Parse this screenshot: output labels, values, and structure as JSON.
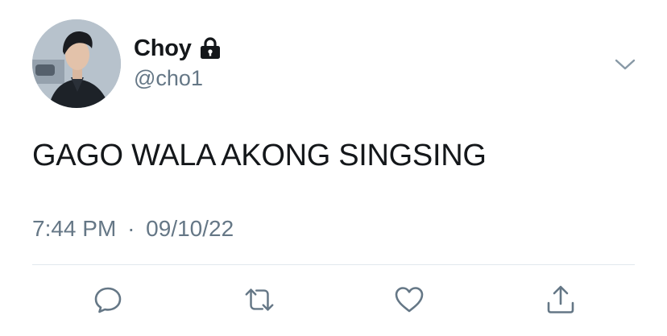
{
  "user": {
    "display_name": "Choy",
    "handle": "@cho1",
    "protected_icon": "lock-icon",
    "avatar": "profile-photo"
  },
  "tweet": {
    "text": "GAGO WALA AKONG SINGSING",
    "time": "7:44 PM",
    "separator": "·",
    "date": "09/10/22"
  },
  "menu_icon": "chevron-down-icon",
  "actions": [
    {
      "name": "reply",
      "icon": "speech-bubble-icon"
    },
    {
      "name": "retweet",
      "icon": "retweet-arrows-icon"
    },
    {
      "name": "like",
      "icon": "heart-icon"
    },
    {
      "name": "share",
      "icon": "share-upload-icon"
    }
  ],
  "colors": {
    "text_primary": "#14171a",
    "text_secondary": "#657786",
    "icon_gray": "#657786",
    "divider": "#e1e8ed"
  }
}
